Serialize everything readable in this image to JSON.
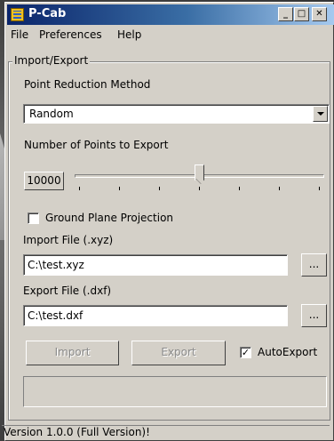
{
  "window": {
    "title": "P-Cab"
  },
  "titlebar": {
    "minimize": "_",
    "maximize": "□",
    "close": "✕"
  },
  "menu": {
    "items": [
      "File",
      "Preferences",
      "Help"
    ]
  },
  "group": {
    "label": "Import/Export"
  },
  "reduction": {
    "label": "Point Reduction Method",
    "selected": "Random"
  },
  "points": {
    "label": "Number of Points to Export",
    "value": "10000",
    "slider_fraction": 0.5
  },
  "ground_plane": {
    "label": "Ground Plane Projection",
    "checked": false
  },
  "import_file": {
    "label": "Import File (.xyz)",
    "value": "C:\\test.xyz",
    "browse_label": "..."
  },
  "export_file": {
    "label": "Export File (.dxf)",
    "value": "C:\\test.dxf",
    "browse_label": "..."
  },
  "actions": {
    "import_label": "Import",
    "export_label": "Export",
    "autoexport_label": "AutoExport",
    "autoexport_checked": true,
    "check_mark": "✓"
  },
  "status": {
    "text": "Version 1.0.0 (Full Version)!"
  }
}
